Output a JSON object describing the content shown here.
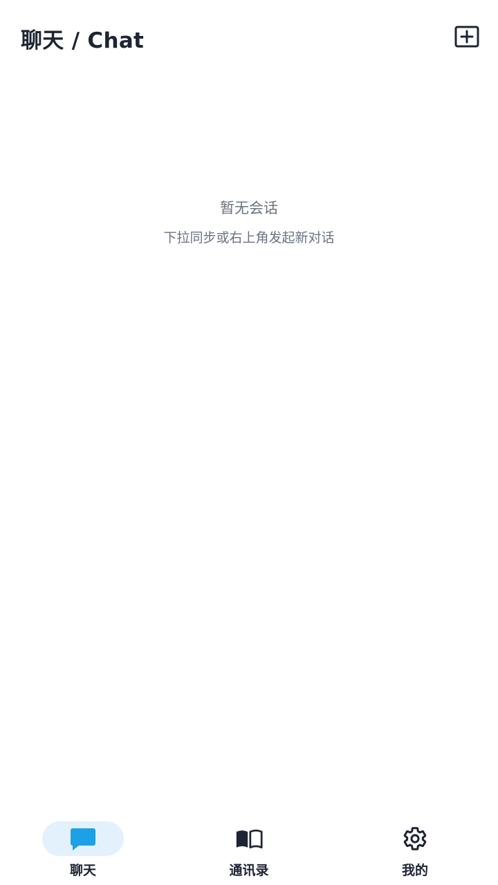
{
  "header": {
    "title": "聊天 / Chat",
    "new_chat_icon": "plus-square-icon"
  },
  "empty_state": {
    "title": "暂无会话",
    "hint": "下拉同步或右上角发起新对话"
  },
  "tabs": [
    {
      "label": "聊天",
      "icon": "chat-bubble-icon",
      "active": true
    },
    {
      "label": "通讯录",
      "icon": "book-icon",
      "active": false
    },
    {
      "label": "我的",
      "icon": "gear-icon",
      "active": false
    }
  ],
  "colors": {
    "accent": "#1da1e6",
    "active_pill": "#e3f1fc",
    "text_dark": "#1e2433",
    "text_muted": "#6b7280"
  }
}
